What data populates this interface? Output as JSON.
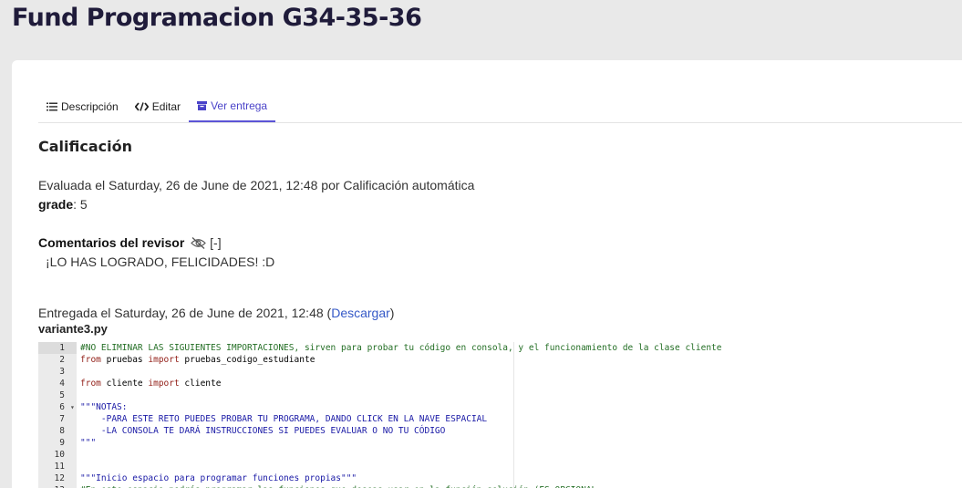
{
  "page": {
    "title": "Fund Programacion G34-35-36"
  },
  "tabs": [
    {
      "label": "Descripción",
      "icon": "list-icon"
    },
    {
      "label": "Editar",
      "icon": "code-icon"
    },
    {
      "label": "Ver entrega",
      "icon": "archive-icon",
      "active": true
    }
  ],
  "grading": {
    "section_title": "Calificación",
    "evaluated": "Evaluada el Saturday, 26 de June de 2021, 12:48 por Calificación automática",
    "grade_label": "grade",
    "grade_value": ": 5",
    "comments_label": "Comentarios del revisor",
    "toggle": "[-]",
    "comment": "¡LO HAS LOGRADO, FELICIDADES! :D"
  },
  "submission": {
    "submitted_prefix": "Entregada el Saturday, 26 de June de 2021, 12:48 (",
    "download_label": "Descargar",
    "submitted_suffix": ")",
    "filename": "variante3.py"
  },
  "code_lines": [
    [
      {
        "t": "#NO ELIMINAR LAS SIGUIENTES IMPORTACIONES, sirven para probar tu código en consola, y el funcionamiento de la clase cliente",
        "c": "comment"
      }
    ],
    [
      {
        "t": "from",
        "c": "keyword"
      },
      {
        "t": " pruebas "
      },
      {
        "t": "import",
        "c": "keyword"
      },
      {
        "t": " pruebas_codigo_estudiante"
      }
    ],
    [],
    [
      {
        "t": "from",
        "c": "keyword"
      },
      {
        "t": " cliente "
      },
      {
        "t": "import",
        "c": "keyword"
      },
      {
        "t": " cliente"
      }
    ],
    [],
    [
      {
        "t": "\"\"\"NOTAS:",
        "c": "string"
      }
    ],
    [
      {
        "t": "    -PARA ESTE RETO PUEDES PROBAR TU PROGRAMA, DANDO CLICK EN LA NAVE ESPACIAL",
        "c": "string"
      }
    ],
    [
      {
        "t": "    -LA CONSOLA TE DARÁ INSTRUCCIONES SI PUEDES EVALUAR O NO TU CÓDIGO",
        "c": "string"
      }
    ],
    [
      {
        "t": "\"\"\"",
        "c": "string"
      }
    ],
    [],
    [],
    [
      {
        "t": "\"\"\"Inicio espacio para programar funciones propias\"\"\"",
        "c": "string"
      }
    ],
    [
      {
        "t": "#En este espacio podrás programar las funciones que deseas usar en la función solución (ES OPCIONAL",
        "c": "comment"
      }
    ]
  ],
  "active_line": 1,
  "fold_line": 6
}
